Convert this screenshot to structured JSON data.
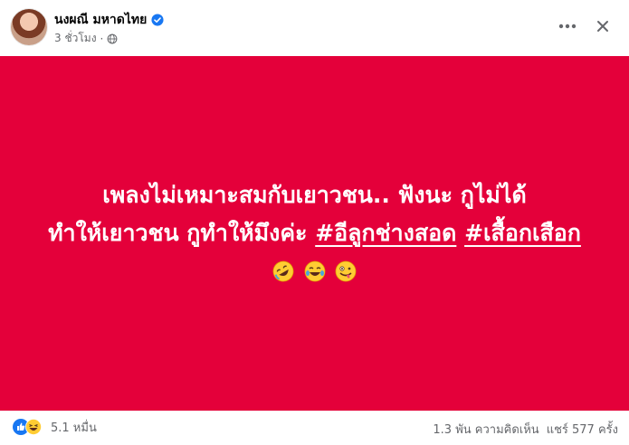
{
  "header": {
    "author_name": "นงผณี มหาดไทย",
    "time_label": "3 ชั่วโมง",
    "separator": "·"
  },
  "post": {
    "background_color": "#e4003a",
    "text_line1": "เพลงไม่เหมาะสมกับเยาวชน.. ฟังนะ กูไม่ได้",
    "text_line2_prefix": "ทำให้เยาวชน กูทำให้มึงค่ะ",
    "hashtag1": "#อีลูกช่างสอด",
    "hashtag2": "#เสื้อกเสือก",
    "emojis": [
      "rolling-on-floor-laughing",
      "tears-of-joy",
      "zany-face"
    ]
  },
  "footer": {
    "reaction_types": [
      "like",
      "haha"
    ],
    "reaction_count": "5.1 หมื่น",
    "comments": "1.3 พัน ความคิดเห็น",
    "shares": "แชร์ 577 ครั้ง"
  },
  "colors": {
    "accent": "#1877f2",
    "secondary_text": "#65676b"
  }
}
